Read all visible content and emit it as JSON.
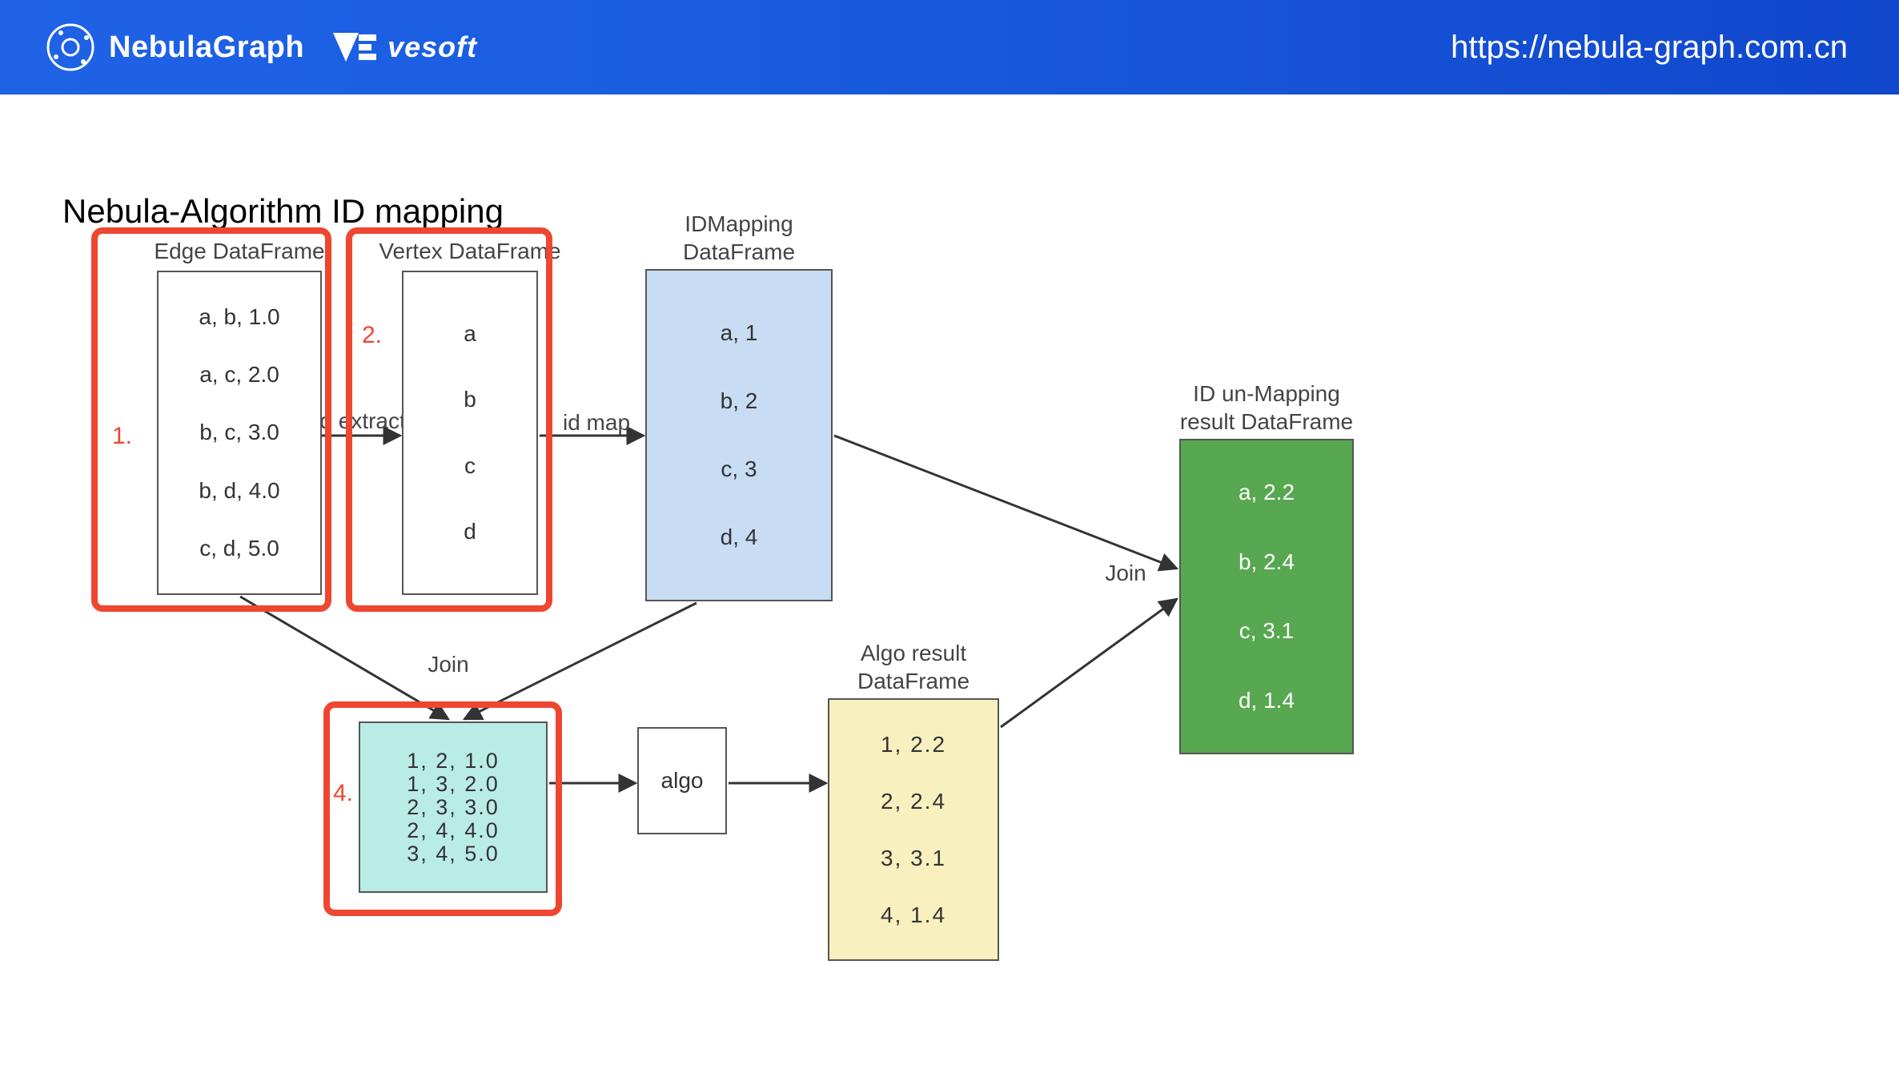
{
  "header": {
    "brand1": "NebulaGraph",
    "brand2": "vesoft",
    "url": "https://nebula-graph.com.cn"
  },
  "title": "Nebula-Algorithm  ID mapping",
  "labels": {
    "edge": "Edge DataFrame",
    "vertex": "Vertex DataFrame",
    "idmap_l1": "IDMapping",
    "idmap_l2": "DataFrame",
    "algores_l1": "Algo result",
    "algores_l2": "DataFrame",
    "result_l1": "ID un-Mapping",
    "result_l2": "result DataFrame",
    "id_extract": "id extract",
    "id_map": "id map",
    "join1": "Join",
    "join2": "Join",
    "algo": "algo"
  },
  "nums": {
    "n1": "1.",
    "n2": "2.",
    "n4": "4."
  },
  "edge_rows": [
    "a, b, 1.0",
    "a, c, 2.0",
    "b, c, 3.0",
    "b, d, 4.0",
    "c, d, 5.0"
  ],
  "vertex_rows": [
    "a",
    "b",
    "c",
    "d"
  ],
  "idmap_rows": [
    "a, 1",
    "b, 2",
    "c, 3",
    "d, 4"
  ],
  "mapped_rows": [
    "1,  2,   1.0",
    "1,  3,   2.0",
    "2,  3,   3.0",
    "2,  4,   4.0",
    "3,  4,   5.0"
  ],
  "algores_rows": [
    "1,  2.2",
    "2,  2.4",
    "3,  3.1",
    "4,  1.4"
  ],
  "result_rows": [
    "a, 2.2",
    "b, 2.4",
    "c, 3.1",
    "d, 1.4"
  ]
}
